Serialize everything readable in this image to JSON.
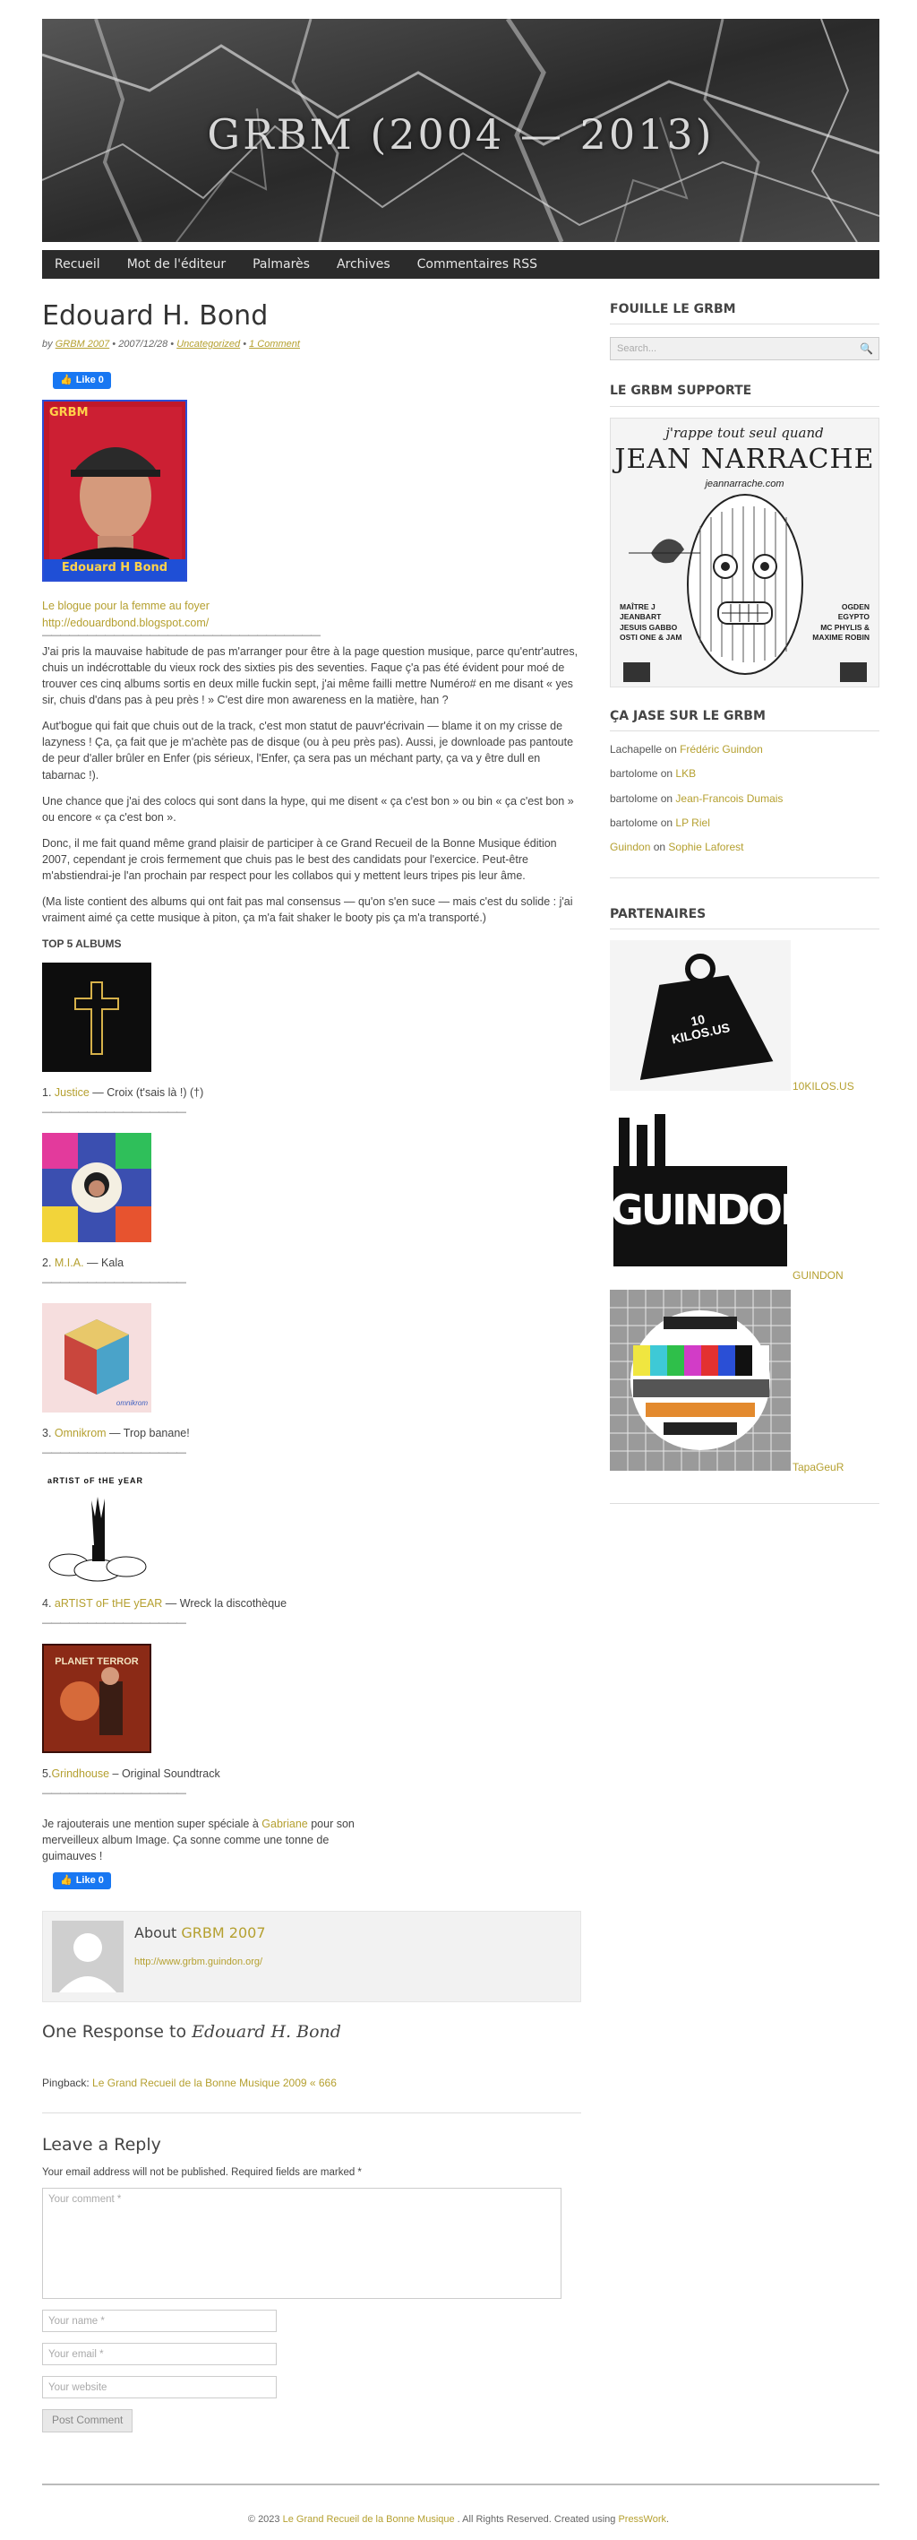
{
  "site": {
    "title": "GRBM (2004 — 2013)"
  },
  "nav": {
    "items": [
      "Recueil",
      "Mot de l'éditeur",
      "Palmarès",
      "Archives",
      "Commentaires RSS"
    ]
  },
  "post": {
    "title": "Edouard H. Bond",
    "meta": {
      "by": "by",
      "author": "GRBM 2007",
      "date": "2007/12/28",
      "category": "Uncategorized",
      "comments": "1 Comment"
    },
    "fb_like": "Like 0",
    "photo": {
      "top_label": "GRBM",
      "caption": "Edouard H Bond"
    },
    "blog_name": "Le blogue pour la femme au foyer",
    "blog_url": "http://edouardbond.blogspot.com/",
    "long_sep": "———————————————————————————————",
    "paragraphs": [
      "J'ai pris la mauvaise habitude de pas m'arranger pour être à la page question musique, parce qu'entr'autres, chuis un indécrottable du vieux rock des sixties pis des seventies. Faque ç'a pas été évident pour moé de trouver ces cinq albums sortis en deux mille fuckin sept, j'ai même failli mettre Numéro# en me disant « yes sir, chuis d'dans pas à peu près ! » C'est dire mon awareness en la matière, han ?",
      "Aut'bogue qui fait que chuis out de la track, c'est mon statut de pauvr'écrivain — blame it on my crisse de lazyness ! Ça, ça fait que je m'achète pas de disque (ou à peu près pas). Aussi, je downloade pas pantoute de peur d'aller brûler en Enfer (pis sérieux, l'Enfer, ça sera pas un méchant party, ça va y être dull en tabarnac !).",
      "Une chance que j'ai des colocs qui sont dans la hype, qui me disent « ça c'est bon » ou bin « ça c'est bon » ou encore « ça c'est bon ».",
      "Donc, il me fait quand même grand plaisir de participer à ce Grand Recueil de la Bonne Musique édition 2007, cependant je crois fermement que chuis pas le best des candidats pour l'exercice. Peut-être m'abstiendrai-je l'an prochain par respect pour les collabos qui y mettent leurs tripes pis leur âme.",
      "(Ma liste contient des albums qui ont fait pas mal consensus — qu'on s'en suce — mais c'est du solide : j'ai vraiment aimé ça cette musique à piton, ça m'a fait shaker le booty pis ça m'a transporté.)"
    ],
    "top5_heading": "TOP 5 ALBUMS",
    "short_sep": "————————————————",
    "albums": [
      {
        "num": "1.",
        "artist": "Justice",
        "rest": " — Croix (t'sais là !) (†)"
      },
      {
        "num": "2.",
        "artist": "M.I.A.",
        "rest": " — Kala"
      },
      {
        "num": "3.",
        "artist": "Omnikrom",
        "rest": " — Trop banane!"
      },
      {
        "num": "4.",
        "artist": "aRTIST oF tHE yEAR",
        "rest": " — Wreck la discothèque"
      },
      {
        "num": "5.",
        "artist": "Grindhouse",
        "rest": " – Original Soundtrack"
      }
    ],
    "album_art_text": {
      "omnikrom": "omnikrom",
      "artist": "aRTIST oF tHE yEAR",
      "planet": "PLANET TERROR"
    },
    "closing_pre": "Je rajouterais une mention super spéciale à ",
    "closing_link": "Gabriane",
    "closing_post": " pour son merveilleux album Image. Ça sonne comme une tonne de guimauves !"
  },
  "author_box": {
    "about": "About",
    "name": "GRBM 2007",
    "url": "http://www.grbm.guindon.org/"
  },
  "responses": {
    "heading_pre": "One Response to ",
    "heading_title": "Edouard H. Bond",
    "pingback_label": "Pingback: ",
    "pingback_link": "Le Grand Recueil de la Bonne Musique 2009 « 666"
  },
  "reply": {
    "heading": "Leave a Reply",
    "note": "Your email address will not be published. Required fields are marked *",
    "comment_placeholder": "Your comment *",
    "name_placeholder": "Your name *",
    "email_placeholder": "Your email *",
    "website_placeholder": "Your website",
    "submit": "Post Comment"
  },
  "sidebar": {
    "search_title": "FOUILLE LE GRBM",
    "search_placeholder": "Search...",
    "support_title": "LE GRBM SUPPORTE",
    "support_ad": {
      "tagline": "j'rappe tout seul quand",
      "name": "JEAN NARRACHE",
      "site": "jeannarrache.com",
      "left_lines": [
        "MAÎTRE J",
        "JEANBART",
        "JESUIS GABBO",
        "OSTI ONE & JAM"
      ],
      "right_lines": [
        "OGDEN",
        "EGYPTO",
        "MC PHYLIS &",
        "MAXIME ROBIN"
      ]
    },
    "jase_title": "ÇA JASE SUR LE GRBM",
    "jase": [
      {
        "who": "Lachapelle",
        "who_link": false,
        "on": " on ",
        "where": "Frédéric Guindon"
      },
      {
        "who": "bartolome",
        "who_link": false,
        "on": " on ",
        "where": "LKB"
      },
      {
        "who": "bartolome",
        "who_link": false,
        "on": " on ",
        "where": "Jean-Francois Dumais"
      },
      {
        "who": "bartolome",
        "who_link": false,
        "on": " on ",
        "where": "LP Riel"
      },
      {
        "who": "Guindon",
        "who_link": true,
        "on": " on ",
        "where": "Sophie Laforest"
      }
    ],
    "partners_title": "PARTENAIRES",
    "partners": [
      {
        "label": "10KILOS.US",
        "logo_text": "10 KILOS.US"
      },
      {
        "label": "GUINDON",
        "logo_text": "GUINDON"
      },
      {
        "label": "TapaGeuR",
        "logo_text": ""
      }
    ]
  },
  "footer": {
    "pre": "© 2023 ",
    "site_link": "Le Grand Recueil de la Bonne Musique",
    "mid": " . All Rights Reserved. Created using ",
    "theme_link": "PressWork",
    "post": "."
  },
  "colors": {
    "accent": "#b5a030",
    "nav_bg": "#2b2b2b",
    "fb_blue": "#1877f2"
  }
}
